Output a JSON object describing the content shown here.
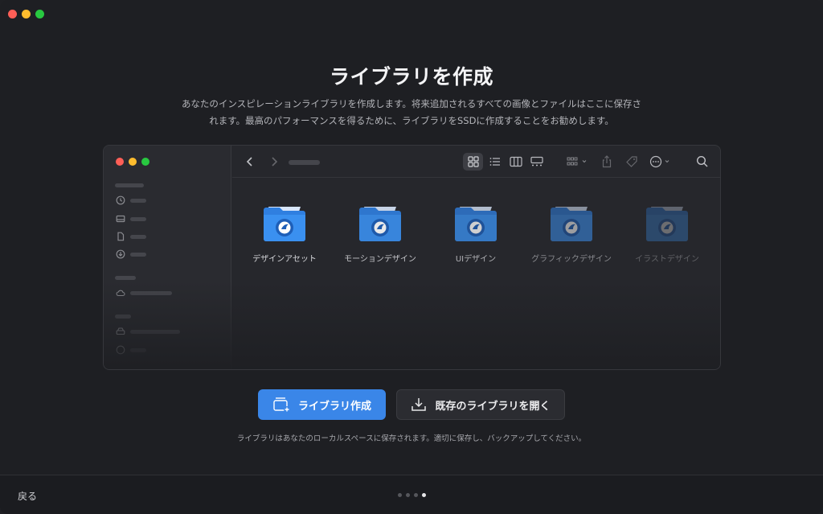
{
  "window": {
    "traffic_lights": [
      "close",
      "minimize",
      "zoom"
    ]
  },
  "header": {
    "title": "ライブラリを作成",
    "description_line1": "あなたのインスピレーションライブラリを作成します。将来追加されるすべての画像とファイルはここに保存さ",
    "description_line2": "れます。最高のパフォーマンスを得るために、ライブラリをSSDに作成することをお勧めします。"
  },
  "preview": {
    "folders": [
      {
        "label": "デザインアセット"
      },
      {
        "label": "モーションデザイン"
      },
      {
        "label": "UIデザイン"
      },
      {
        "label": "グラフィックデザイン"
      },
      {
        "label": "イラストデザイン"
      }
    ],
    "toolbar_icons": [
      "back-icon",
      "forward-icon",
      "grid-view-icon",
      "list-view-icon",
      "column-view-icon",
      "gallery-view-icon",
      "group-icon",
      "share-icon",
      "tag-icon",
      "more-icon",
      "search-icon"
    ]
  },
  "actions": {
    "create_label": "ライブラリ作成",
    "open_label": "既存のライブラリを開く",
    "note": "ライブラリはあなたのローカルスペースに保存されます。適切に保存し、バックアップしてください。"
  },
  "footer": {
    "back_label": "戻る",
    "page_total": 4,
    "page_current": 4
  },
  "colors": {
    "accent": "#3a86e8",
    "background": "#1e1f23"
  }
}
